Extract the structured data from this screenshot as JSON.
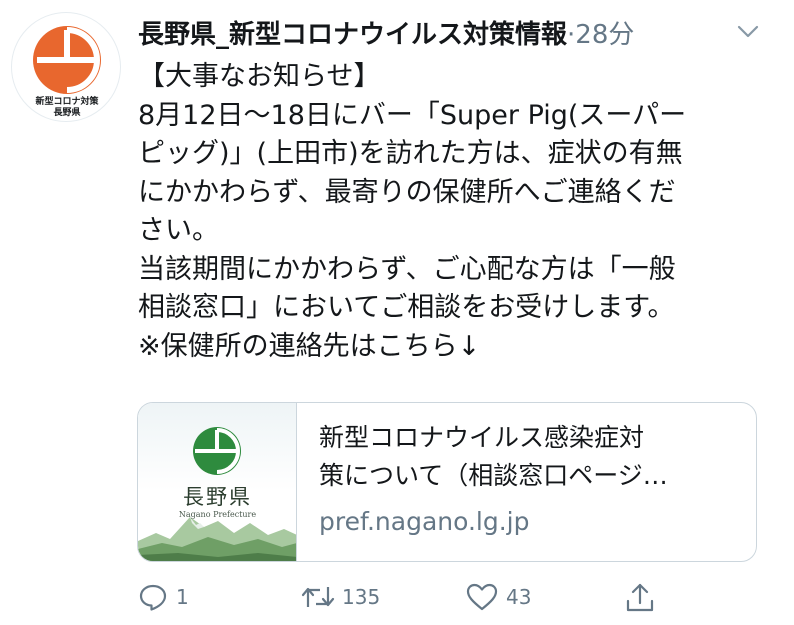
{
  "tweet": {
    "author_name": "長野県_新型コロナウイルス対策情報",
    "separator": "·",
    "timestamp": "28分",
    "avatar": {
      "caption_line1": "新型コロナ対策",
      "caption_line2": "長野県",
      "accent_color": "#e8672e"
    },
    "text_lines": [
      "【大事なお知らせ】",
      "8月12日〜18日にバー「Super Pig(スーパー",
      "ピッグ)」(上田市)を訪れた方は、症状の有無",
      "にかかわらず、最寄りの保健所へご連絡くだ",
      "さい。",
      "当該期間にかかわらず、ご心配な方は「一般",
      "相談窓口」においてご相談をお受けします。",
      "※保健所の連絡先はこちら↓"
    ],
    "card": {
      "thumb_title": "長野県",
      "thumb_subtitle": "Nagano Prefecture",
      "title_line1": "新型コロナウイルス感染症対",
      "title_line2": "策について（相談窓口ページ…",
      "domain": "pref.nagano.lg.jp",
      "logo_color": "#2e8b3e"
    },
    "actions": {
      "reply_count": "1",
      "retweet_count": "135",
      "like_count": "43"
    },
    "colors": {
      "text": "#14171a",
      "secondary": "#657786",
      "border": "#ccd6dd"
    }
  }
}
